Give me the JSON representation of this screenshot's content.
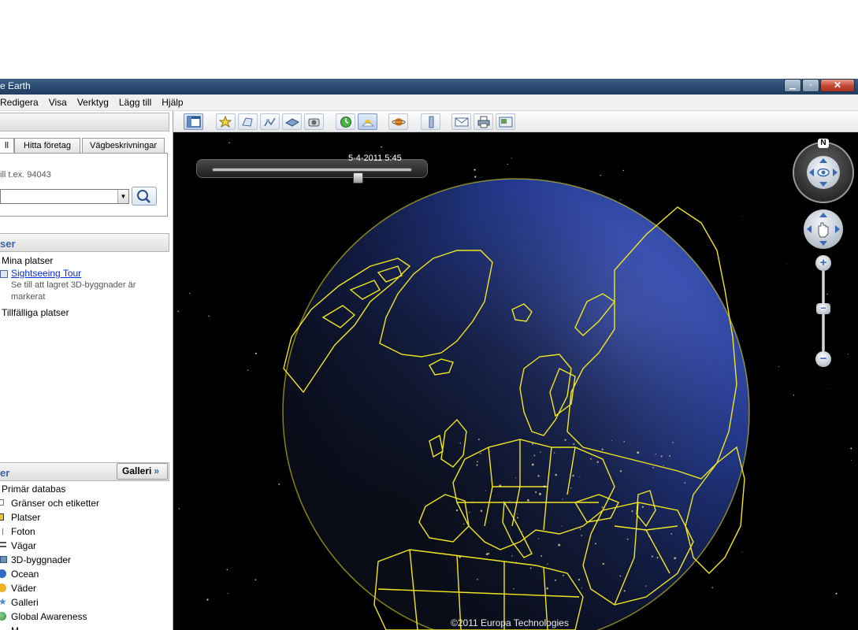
{
  "window": {
    "title": "e Earth",
    "minimize": "▁",
    "maximize": "▫",
    "close": "✕"
  },
  "menu": [
    "Redigera",
    "Visa",
    "Verktyg",
    "Lägg till",
    "Hjälp"
  ],
  "search": {
    "tabs": [
      "ll",
      "Hitta företag",
      "Vägbeskrivningar"
    ],
    "hint": "ill t.ex. 94043",
    "input_value": ""
  },
  "places": {
    "header": "ser",
    "items": [
      {
        "label": "Mina platser",
        "kind": "folder"
      },
      {
        "label": "Sightseeing Tour",
        "kind": "link"
      },
      {
        "label": "Se till att lagret 3D-byggnader är",
        "kind": "desc"
      },
      {
        "label": "markerat",
        "kind": "desc"
      },
      {
        "label": "Tillfälliga platser",
        "kind": "folder"
      }
    ]
  },
  "layers": {
    "header": "er",
    "gallery_button": "Galleri",
    "gallery_chevron": "»",
    "items": [
      {
        "label": "Primär databas",
        "icon": "database-icon",
        "color": "#3a62a6"
      },
      {
        "label": "Gränser och etiketter",
        "icon": "borders-icon",
        "color": "#888888"
      },
      {
        "label": "Platser",
        "icon": "places-icon",
        "color": "#e5c23a"
      },
      {
        "label": "Foton",
        "icon": "photos-icon",
        "color": "#777777"
      },
      {
        "label": "Vägar",
        "icon": "roads-icon",
        "color": "#555555"
      },
      {
        "label": "3D-byggnader",
        "icon": "buildings-icon",
        "color": "#6a8fb8"
      },
      {
        "label": "Ocean",
        "icon": "ocean-icon",
        "color": "#2b6cc4"
      },
      {
        "label": "Väder",
        "icon": "weather-icon",
        "color": "#f0b020"
      },
      {
        "label": "Galleri",
        "icon": "gallery-icon",
        "color": "#4a8ad0"
      },
      {
        "label": "Global Awareness",
        "icon": "globe-icon",
        "color": "#3aa04a"
      },
      {
        "label": "M",
        "icon": "more-icon",
        "color": "#777777"
      }
    ]
  },
  "toolbar": {
    "buttons": [
      {
        "name": "hide-sidebar-icon",
        "active": true
      },
      {
        "name": "add-placemark-icon"
      },
      {
        "name": "add-polygon-icon"
      },
      {
        "name": "add-path-icon"
      },
      {
        "name": "add-overlay-icon"
      },
      {
        "name": "record-tour-icon"
      },
      {
        "name": "historical-imagery-icon"
      },
      {
        "name": "sunlight-icon",
        "active": true
      },
      {
        "name": "planets-icon"
      },
      {
        "name": "ruler-icon"
      },
      {
        "name": "email-icon"
      },
      {
        "name": "print-icon"
      },
      {
        "name": "save-image-icon"
      }
    ]
  },
  "map": {
    "time_label": "5-4-2011   5:45",
    "time_position": 0.74,
    "copyright": "©2011 Europa Technologies",
    "north_label": "N",
    "zoom_plus": "+",
    "zoom_minus": "−",
    "zoom_level": 0.6,
    "colors": {
      "ocean": "#1c2f6e",
      "borders": "#f2e620",
      "space": "#000000"
    }
  }
}
